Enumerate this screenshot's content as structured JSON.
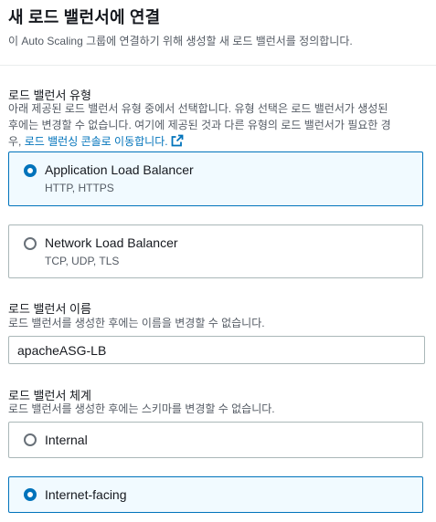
{
  "header": {
    "title": "새 로드 밸런서에 연결",
    "description": "이 Auto Scaling 그룹에 연결하기 위해 생성할 새 로드 밸런서를 정의합니다."
  },
  "lb_type": {
    "label": "로드 밸런서 유형",
    "desc_line1": "아래 제공된 로드 밸런서 유형 중에서 선택합니다. 유형 선택은 로드 밸런서가 생성된",
    "desc_line2": "후에는 변경할 수 없습니다. 여기에 제공된 것과 다른 유형의 로드 밸런서가 필요한 경",
    "desc_line3_prefix": "우, ",
    "desc_link": "로드 밸런싱 콘솔로 이동합니다.",
    "options": [
      {
        "title": "Application Load Balancer",
        "subtitle": "HTTP, HTTPS",
        "selected": true
      },
      {
        "title": "Network Load Balancer",
        "subtitle": "TCP, UDP, TLS",
        "selected": false
      }
    ]
  },
  "lb_name": {
    "label": "로드 밸런서 이름",
    "description": "로드 밸런서를 생성한 후에는 이름을 변경할 수 없습니다.",
    "value": "apacheASG-LB"
  },
  "lb_scheme": {
    "label": "로드 밸런서 체계",
    "description": "로드 밸런서를 생성한 후에는 스키마를 변경할 수 없습니다.",
    "options": [
      {
        "title": "Internal",
        "selected": false
      },
      {
        "title": "Internet-facing",
        "selected": true
      }
    ]
  },
  "colors": {
    "accent": "#0073bb",
    "selected_background": "#f1faff",
    "border": "#aab7b8",
    "secondary_text": "#545b64"
  },
  "icons": {
    "external_link": "external-link-icon"
  }
}
